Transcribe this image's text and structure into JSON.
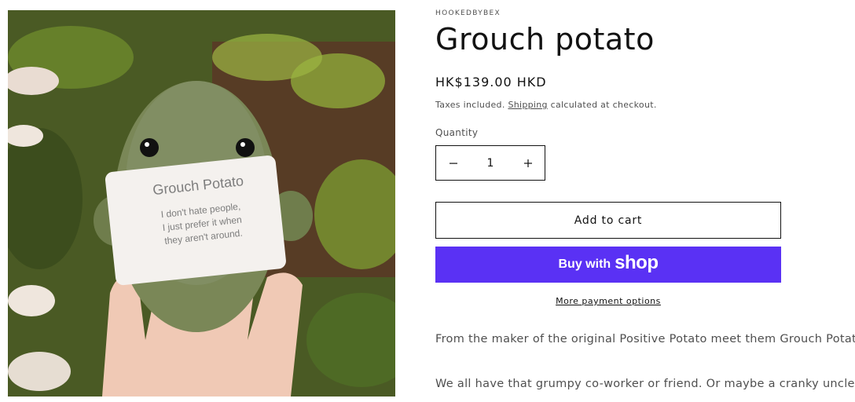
{
  "product": {
    "vendor": "HOOKEDBYBEX",
    "title": "Grouch potato",
    "price": "HK$139.00 HKD",
    "tax_prefix": "Taxes included.",
    "tax_link": "Shipping",
    "tax_suffix": "calculated at checkout.",
    "image_card": {
      "heading": "Grouch Potato",
      "line1": "I don't hate people,",
      "line2": "I just prefer it when",
      "line3": "they aren't around."
    }
  },
  "quantity": {
    "label": "Quantity",
    "value": "1",
    "minus_icon": "minus-icon",
    "plus_icon": "plus-icon"
  },
  "buttons": {
    "add_to_cart": "Add to cart",
    "buy_with": "Buy with",
    "shop_logo": "shop",
    "more_payment": "More payment options",
    "shop_color": "#5a31f4"
  },
  "description": {
    "p1": "From the maker of the original Positive Potato meet them Grouch Potato!",
    "p2": "We all have that grumpy co-worker or friend. Or maybe a cranky uncle or"
  }
}
